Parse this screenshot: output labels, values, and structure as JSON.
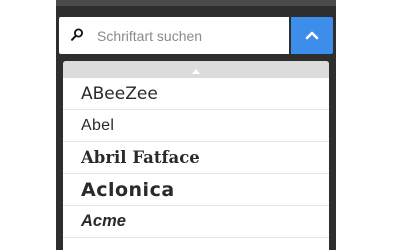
{
  "search": {
    "placeholder": "Schriftart suchen",
    "value": ""
  },
  "icons": {
    "search": "search-icon",
    "collapse": "chevron-up-icon",
    "scroll_up": "caret-up-icon"
  },
  "colors": {
    "panel_background": "#2e2e2e",
    "accent": "#3d8eea",
    "list_background": "#ffffff",
    "scroll_bar": "#dcdcdc"
  },
  "fonts": [
    {
      "label": "ABeeZee"
    },
    {
      "label": "Abel"
    },
    {
      "label": "Abril Fatface"
    },
    {
      "label": "Aclonica"
    },
    {
      "label": "Acme"
    }
  ]
}
